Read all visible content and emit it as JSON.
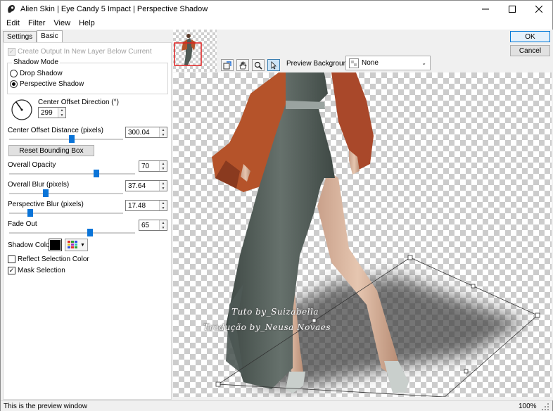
{
  "window": {
    "title": "Alien Skin | Eye Candy 5 Impact | Perspective Shadow",
    "minimize_icon": "minimize-icon",
    "maximize_icon": "maximize-icon",
    "close_icon": "close-icon"
  },
  "menu": [
    "Edit",
    "Filter",
    "View",
    "Help"
  ],
  "tabs": [
    {
      "label": "Settings",
      "active": false
    },
    {
      "label": "Basic",
      "active": true
    }
  ],
  "basic": {
    "create_output_label": "Create Output In New Layer Below Current",
    "create_output_checked": true,
    "create_output_disabled": true,
    "shadow_mode_label": "Shadow Mode",
    "modes": [
      {
        "label": "Drop Shadow",
        "selected": false
      },
      {
        "label": "Perspective Shadow",
        "selected": true
      }
    ],
    "direction_label": "Center Offset Direction (°)",
    "direction_value": "299",
    "distance_label": "Center Offset Distance (pixels)",
    "distance_value": "300.04",
    "distance_level": 0.55,
    "reset_label": "Reset Bounding Box",
    "opacity_label": "Overall Opacity",
    "opacity_value": "70",
    "opacity_level": 0.7,
    "blur_label": "Overall Blur (pixels)",
    "blur_value": "37.64",
    "blur_level": 0.31,
    "pblur_label": "Perspective Blur (pixels)",
    "pblur_value": "17.48",
    "pblur_level": 0.17,
    "fade_label": "Fade Out",
    "fade_value": "65",
    "fade_level": 0.65,
    "shadow_color_label": "Shadow Color",
    "shadow_color": "#000000",
    "reflect_label": "Reflect Selection Color",
    "reflect_checked": false,
    "mask_label": "Mask Selection",
    "mask_checked": true
  },
  "preview": {
    "background_label": "Preview Background:",
    "background_value": "None",
    "tools": [
      "navigate-icon",
      "hand-icon",
      "zoom-icon",
      "pointer-icon"
    ],
    "selected_tool": "pointer-icon"
  },
  "buttons": {
    "ok": "OK",
    "cancel": "Cancel"
  },
  "watermark": {
    "line1": "Tuto by_Suizabella",
    "line2": "Tradução by_Neusa Novaes"
  },
  "status": {
    "text": "This is the preview window",
    "zoom": "100%"
  },
  "colors": {
    "accent": "#0a74d8",
    "dress": "#4f5a55",
    "cardigan": "#b5532a",
    "skin": "#d9b49a"
  }
}
